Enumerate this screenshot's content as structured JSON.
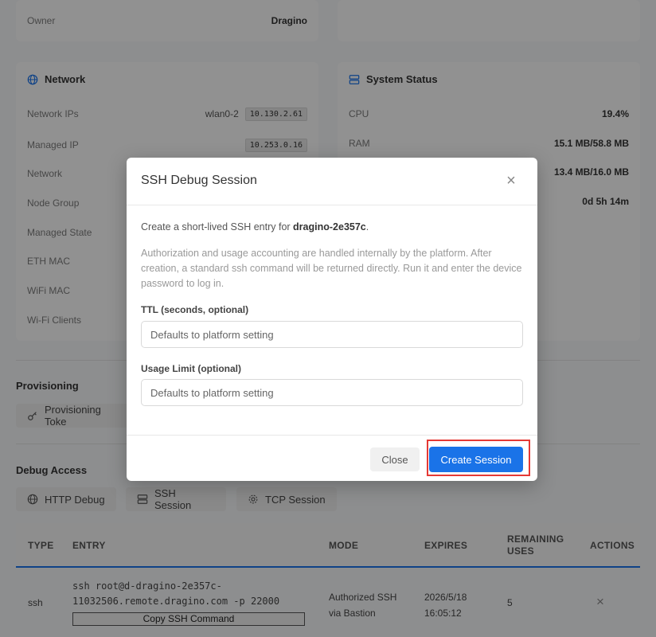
{
  "owner_card": {
    "label": "Owner",
    "value": "Dragino"
  },
  "network": {
    "title": "Network",
    "rows": [
      {
        "label": "Network IPs",
        "iface": "wlan0-2",
        "value": "10.130.2.61"
      },
      {
        "label": "Managed IP",
        "value": "10.253.0.16"
      },
      {
        "label": "Network"
      },
      {
        "label": "Node Group"
      },
      {
        "label": "Managed State"
      },
      {
        "label": "ETH MAC"
      },
      {
        "label": "WiFi MAC"
      },
      {
        "label": "Wi-Fi Clients"
      }
    ]
  },
  "system_status": {
    "title": "System Status",
    "rows": [
      {
        "label": "CPU",
        "value": "19.4%"
      },
      {
        "label": "RAM",
        "value": "15.1 MB/58.8 MB"
      },
      {
        "value": "13.4 MB/16.0 MB"
      },
      {
        "value": "0d 5h 14m"
      }
    ]
  },
  "provisioning": {
    "title": "Provisioning",
    "token_button": "Provisioning Toke"
  },
  "debug_access": {
    "title": "Debug Access",
    "buttons": [
      "HTTP Debug",
      "SSH Session",
      "TCP Session"
    ]
  },
  "table": {
    "headers": [
      "TYPE",
      "ENTRY",
      "MODE",
      "EXPIRES",
      "REMAINING USES",
      "ACTIONS"
    ],
    "rows": [
      {
        "type": "ssh",
        "entry_line1": "ssh root@d-dragino-2e357c-",
        "entry_line2": "11032506.remote.dragino.com -p 22000",
        "copy_label": "Copy SSH Command",
        "mode": "Authorized SSH via Bastion",
        "expires_date": "2026/5/18",
        "expires_time": "16:05:12",
        "remaining": "5",
        "action": "×"
      }
    ]
  },
  "modal": {
    "title": "SSH Debug Session",
    "close_icon": "×",
    "intro_prefix": "Create a short-lived SSH entry for ",
    "device": "dragino-2e357c",
    "intro_suffix": ".",
    "note": "Authorization and usage accounting are handled internally by the platform. After creation, a standard ssh command will be returned directly. Run it and enter the device password to log in.",
    "ttl_label": "TTL (seconds, optional)",
    "ttl_placeholder": "Defaults to platform setting",
    "usage_label": "Usage Limit (optional)",
    "usage_placeholder": "Defaults to platform setting",
    "close_button": "Close",
    "create_button": "Create Session"
  },
  "colors": {
    "accent": "#1a73e8",
    "highlight": "#e53935"
  }
}
